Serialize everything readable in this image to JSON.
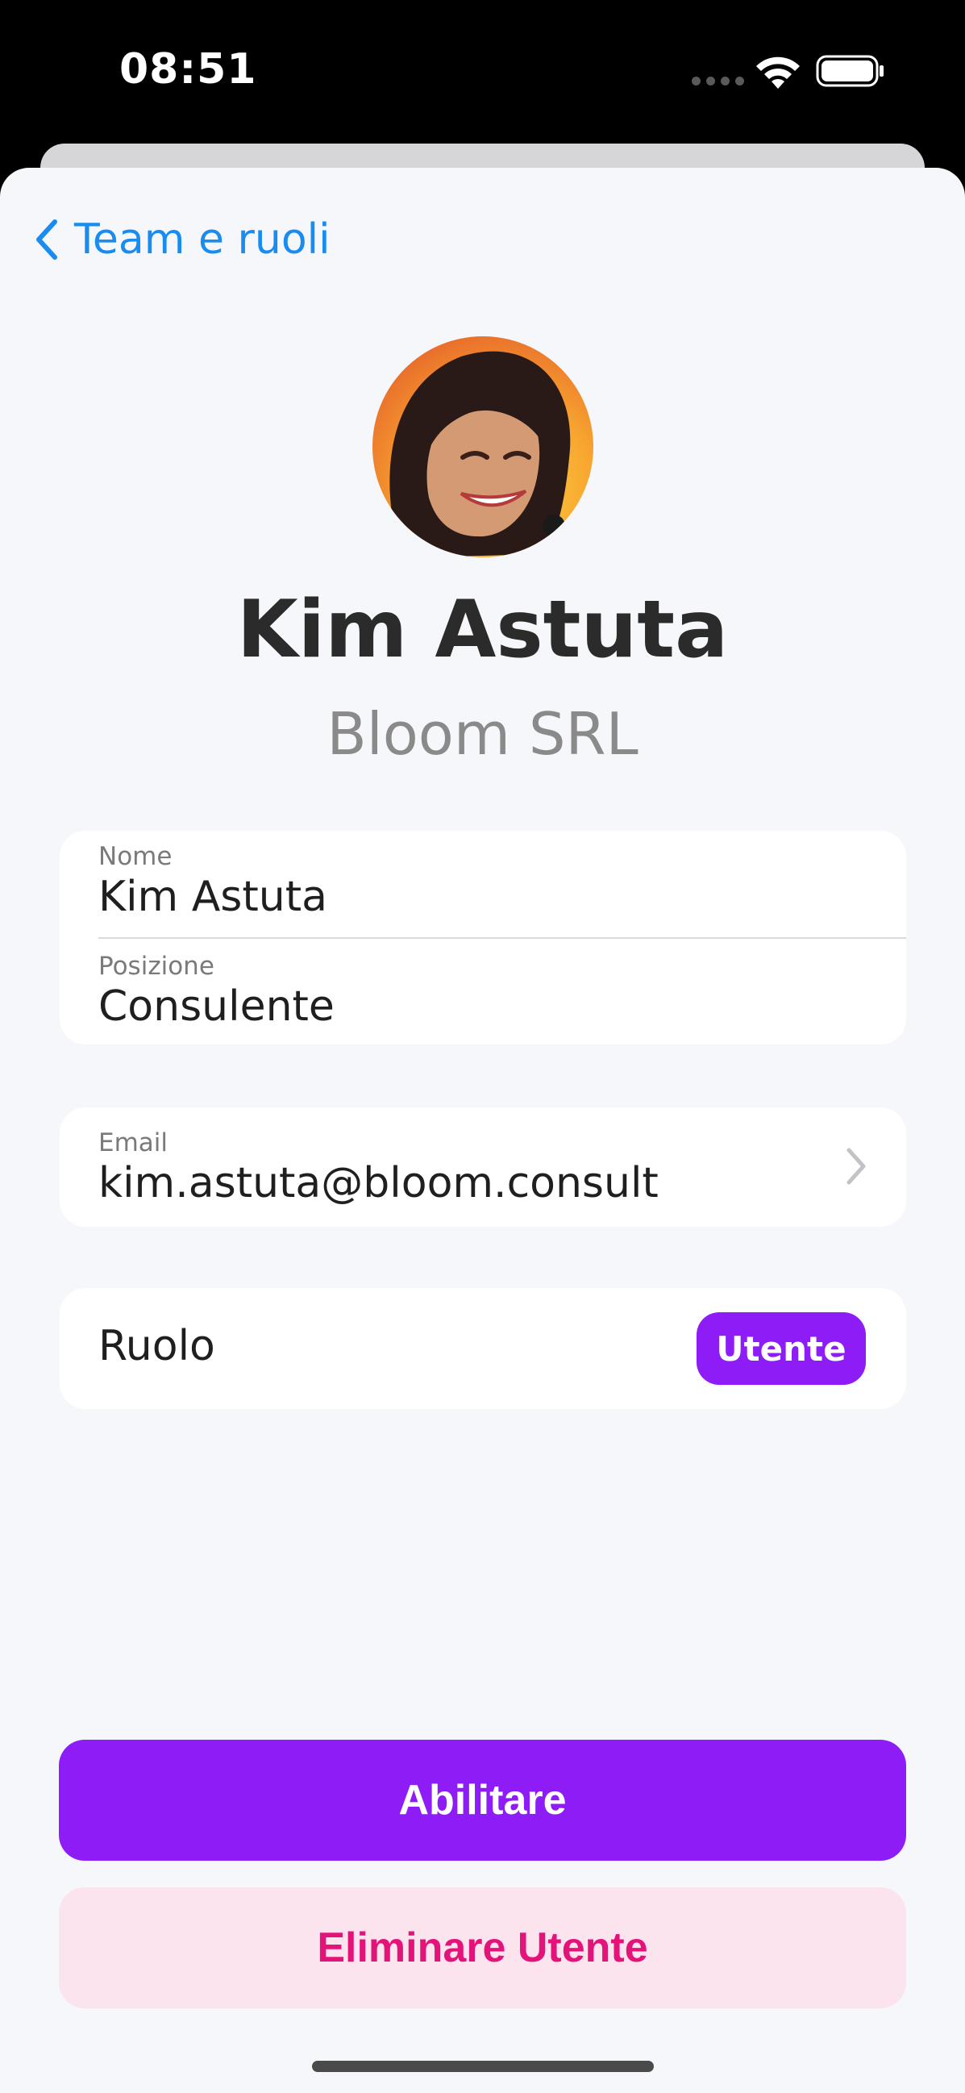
{
  "status_bar": {
    "time": "08:51"
  },
  "nav": {
    "back_label": "Team e ruoli"
  },
  "profile": {
    "name": "Kim Astuta",
    "company": "Bloom SRL"
  },
  "fields": {
    "name_label": "Nome",
    "name_value": "Kim Astuta",
    "position_label": "Posizione",
    "position_value": "Consulente",
    "email_label": "Email",
    "email_value": "kim.astuta@bloom.consult"
  },
  "role": {
    "label": "Ruolo",
    "value": "Utente"
  },
  "actions": {
    "enable_label": "Abilitare",
    "delete_label": "Eliminare Utente"
  },
  "colors": {
    "accent": "#8d1cf7",
    "link": "#1a8cf0",
    "danger": "#e4137a",
    "danger_bg": "#fce4ee",
    "sheet_bg": "#f5f7fa"
  }
}
